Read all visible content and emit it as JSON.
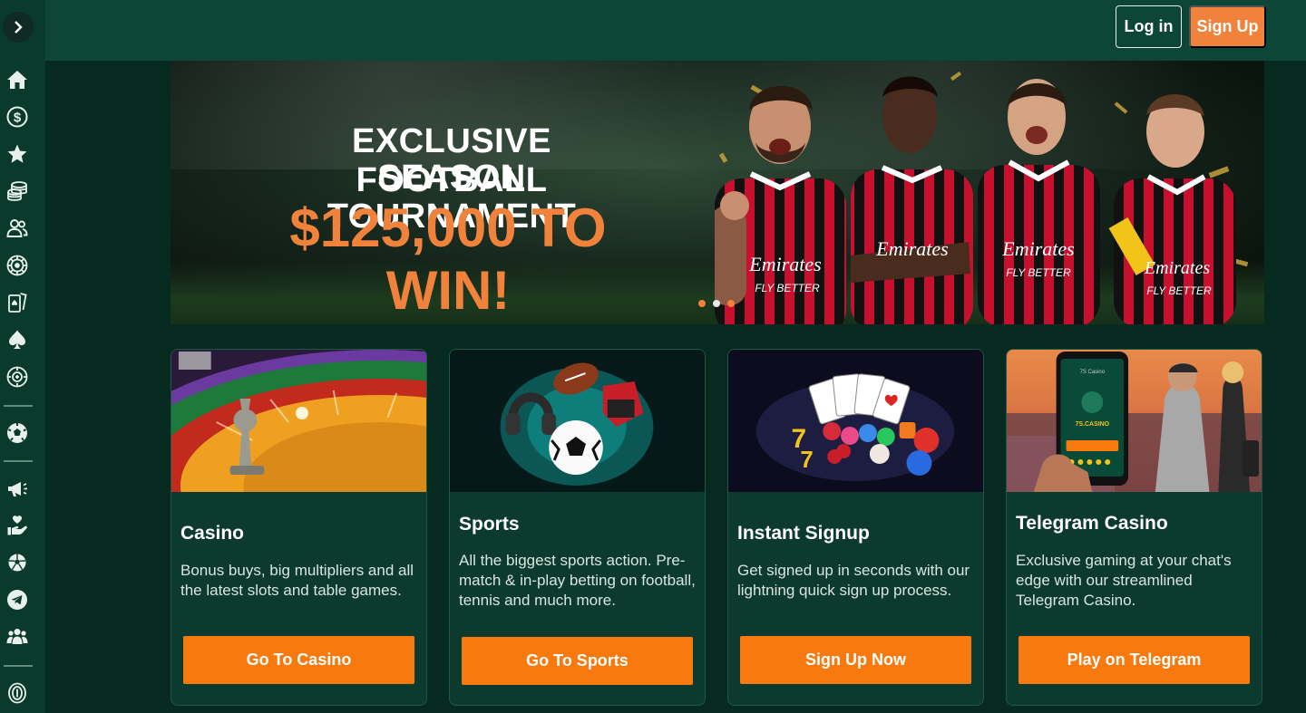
{
  "header": {
    "login_label": "Log in",
    "signup_label": "Sign Up"
  },
  "sidebar": {
    "toggle_icon": "chevron-right-icon",
    "items": [
      {
        "icon": "home-icon"
      },
      {
        "icon": "dollar-icon"
      },
      {
        "icon": "star-icon"
      },
      {
        "icon": "coins-stack-icon"
      },
      {
        "icon": "users-icon"
      },
      {
        "icon": "roulette-icon"
      },
      {
        "icon": "playing-cards-icon"
      },
      {
        "icon": "spade-icon"
      },
      {
        "icon": "poker-chip-icon"
      },
      {
        "icon": "soccer-ball-icon"
      },
      {
        "icon": "megaphone-icon"
      },
      {
        "icon": "hand-heart-icon"
      },
      {
        "icon": "sports-ball-icon"
      },
      {
        "icon": "telegram-icon"
      },
      {
        "icon": "community-icon"
      },
      {
        "icon": "coin-icon"
      }
    ]
  },
  "banner": {
    "line1": "EXCLUSIVE FOOTBALL",
    "line2": "SEASON TOURNAMENT",
    "prize": "$125,000 TO WIN!",
    "slides": 3,
    "active_slide": 2,
    "shirt_sponsor": "Emirates",
    "shirt_tagline": "FLY BETTER"
  },
  "cards": [
    {
      "title": "Casino",
      "description": "Bonus buys, big multipliers and all the latest slots and table games.",
      "button": "Go To Casino"
    },
    {
      "title": "Sports",
      "description": "All the biggest sports action. Pre-match & in-play betting on football, tennis and much more.",
      "button": "Go To Sports"
    },
    {
      "title": "Instant Signup",
      "description": "Get signed up in seconds with our lightning quick sign up process.",
      "button": "Sign Up Now"
    },
    {
      "title": "Telegram Casino",
      "description": "Exclusive gaming at your chat's edge with our streamlined Telegram Casino.",
      "button": "Play on Telegram"
    }
  ],
  "telegram_phone": {
    "brand": "7S.CASINO"
  },
  "colors": {
    "accent": "#f87a0e",
    "background": "#062a20",
    "header": "#0d4536",
    "card": "#0d3a2e"
  }
}
